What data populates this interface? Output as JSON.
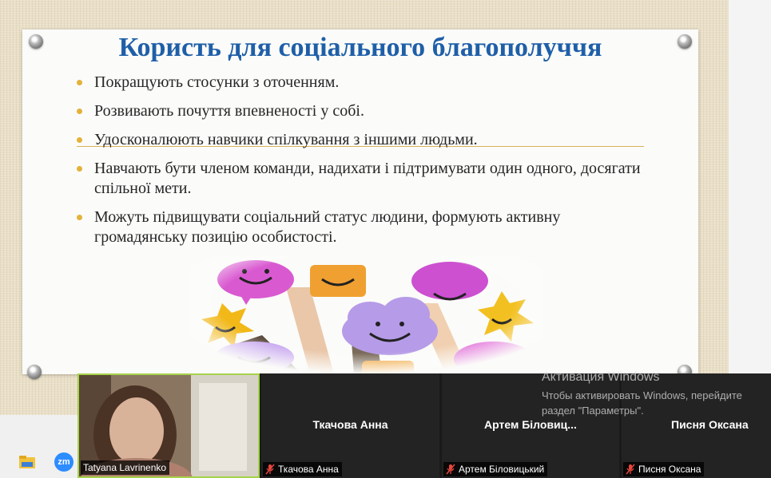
{
  "slide": {
    "title": "Користь для соціального благополуччя",
    "bullets": [
      "Покращують стосунки з оточенням.",
      "Розвивають почуття впевненості у собі.",
      "Удосконалюють навчики спілкування з іншими людьми.",
      "Навчають бути членом команди, надихати і підтримувати один одного, досягати спільної мети.",
      "Можуть підвищувати соціальний статус людини, формують активну громадянську позицію особистості."
    ],
    "bullet_color": "#e2b23a",
    "title_color": "#1f5fa8"
  },
  "participants": [
    {
      "name": "Tatyana Lavrinenko",
      "video_on": true
    },
    {
      "display": "Ткачова Анна",
      "name": "Ткачова Анна",
      "muted": true
    },
    {
      "display": "Артем Біловиц...",
      "name": "Артем Біловицький",
      "muted": true
    },
    {
      "display": "Писня Оксана",
      "name": "Писня Оксана",
      "muted": true
    }
  ],
  "watermark": {
    "title": "Активация Windows",
    "line1": "Чтобы активировать Windows, перейдите",
    "line2": "раздел \"Параметры\"."
  },
  "taskbar": {
    "icons": [
      "file-explorer-icon",
      "zoom-icon"
    ],
    "zoom_label": "zm"
  }
}
